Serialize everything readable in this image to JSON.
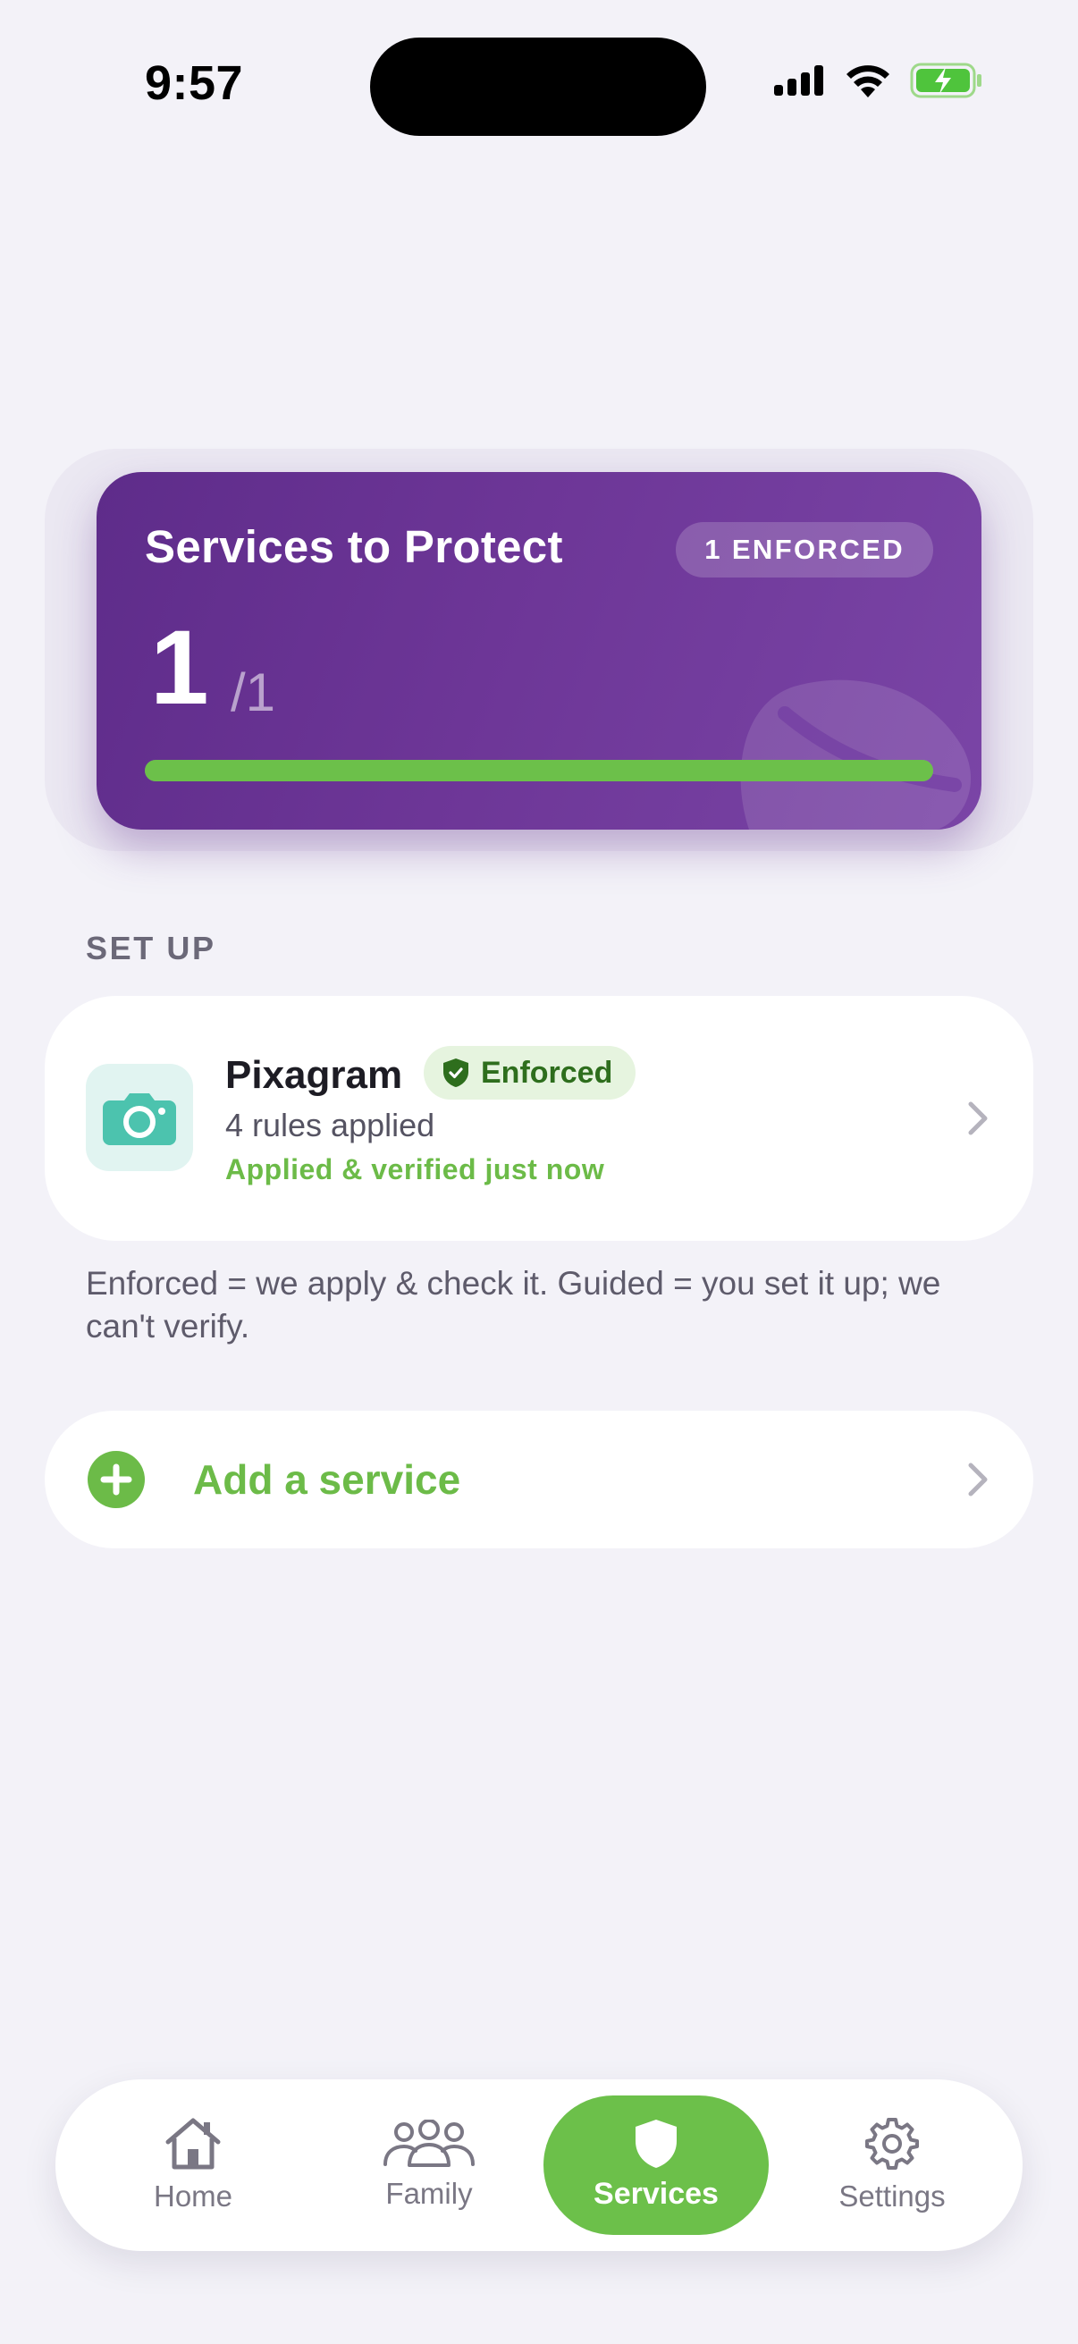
{
  "status_bar": {
    "time": "9:57",
    "icons": [
      "cellular-signal-icon",
      "wifi-icon",
      "battery-charging-icon"
    ]
  },
  "hero": {
    "title": "Services to Protect",
    "badge": "1 ENFORCED",
    "count": "1",
    "total": "/1",
    "progress_fraction": 1.0,
    "colors": {
      "card": "#6d3697",
      "progress": "#6cc04a"
    }
  },
  "setup": {
    "section_label": "SET UP",
    "service": {
      "name": "Pixagram",
      "status": "Enforced",
      "rules": "4 rules applied",
      "verified": "Applied & verified just now",
      "icon": "camera-icon"
    },
    "explanation": "Enforced = we apply & check it. Guided = you set it up; we can't verify."
  },
  "add_service": {
    "label": "Add a service"
  },
  "tabbar": {
    "tabs": [
      {
        "label": "Home",
        "icon": "home-icon"
      },
      {
        "label": "Family",
        "icon": "family-icon"
      },
      {
        "label": "Services",
        "icon": "shield-icon",
        "active": true
      },
      {
        "label": "Settings",
        "icon": "gear-icon"
      }
    ]
  }
}
